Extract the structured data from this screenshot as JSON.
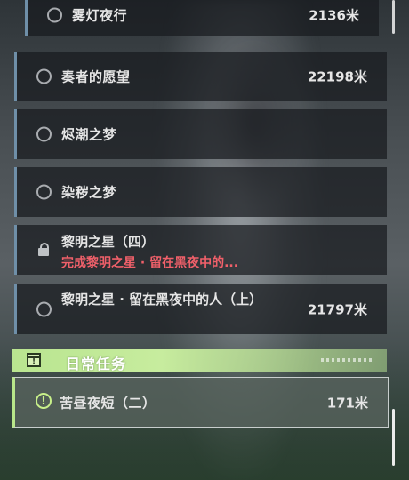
{
  "quests": [
    {
      "title": "雾灯夜行",
      "distance": "2136米"
    },
    {
      "title": "奏者的愿望",
      "distance": "22198米"
    },
    {
      "title": "烬潮之梦",
      "distance": ""
    },
    {
      "title": "染秽之梦",
      "distance": ""
    }
  ],
  "locked_quest": {
    "title": "黎明之星（四）",
    "subtitle": "完成黎明之星 · 留在黑夜中的..."
  },
  "multi_quest": {
    "title": "黎明之星 · 留在黑夜中的人（上）",
    "distance": "21797米"
  },
  "daily_section": {
    "title": "日常任务"
  },
  "daily_quest": {
    "title": "苦昼夜短（二）",
    "distance": "171米"
  },
  "colors": {
    "accent_green": "#b9e590",
    "warning_red": "#f0606a",
    "row_border": "#6f8fa8"
  },
  "icons": {
    "quest": "circle-icon",
    "locked": "lock-icon",
    "daily": "task-board-icon",
    "active": "exclamation-icon"
  }
}
